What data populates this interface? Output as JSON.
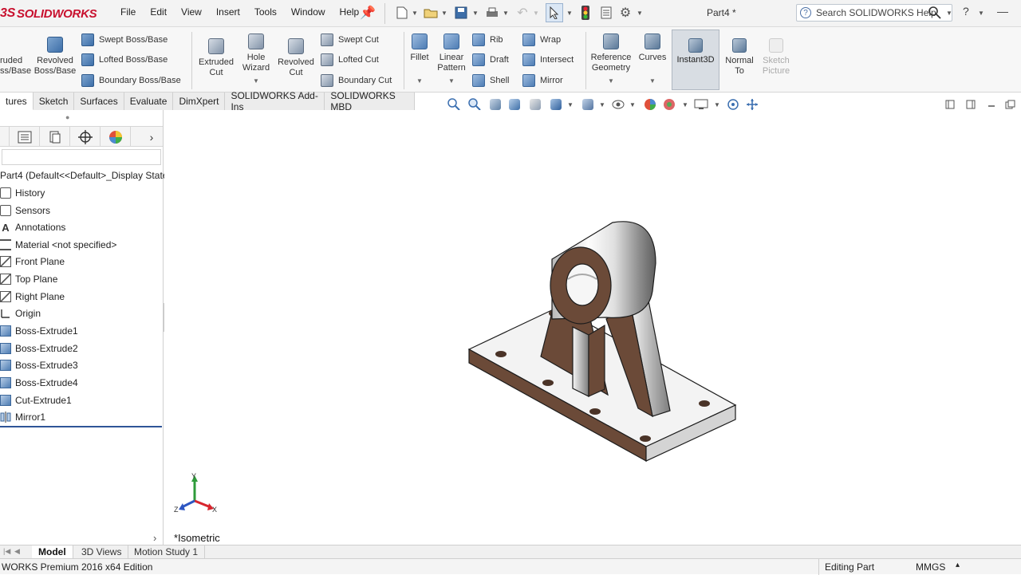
{
  "app": {
    "logo_prefix": "3S",
    "logo_text": "SOLIDWORKS",
    "doc_title": "Part4 *"
  },
  "menu": [
    "File",
    "Edit",
    "View",
    "Insert",
    "Tools",
    "Window",
    "Help"
  ],
  "search": {
    "placeholder": "Search SOLIDWORKS Help"
  },
  "window_controls": {
    "help": "?",
    "minimize": "—",
    "restore": "❐",
    "close": "✕"
  },
  "ribbon": {
    "extruded": "ruded\nss/Base",
    "revolved": "Revolved\nBoss/Base",
    "swept_boss": "Swept Boss/Base",
    "lofted_boss": "Lofted Boss/Base",
    "boundary_boss": "Boundary Boss/Base",
    "extruded_cut": "Extruded\nCut",
    "hole_wizard": "Hole\nWizard",
    "revolved_cut": "Revolved\nCut",
    "swept_cut": "Swept Cut",
    "lofted_cut": "Lofted Cut",
    "boundary_cut": "Boundary Cut",
    "fillet": "Fillet",
    "linear_pattern": "Linear\nPattern",
    "rib": "Rib",
    "draft": "Draft",
    "shell": "Shell",
    "wrap": "Wrap",
    "intersect": "Intersect",
    "mirror": "Mirror",
    "reference_geometry": "Reference\nGeometry",
    "curves": "Curves",
    "instant3d": "Instant3D",
    "normal_to": "Normal\nTo",
    "sketch_picture": "Sketch\nPicture"
  },
  "tabs": [
    "tures",
    "Sketch",
    "Surfaces",
    "Evaluate",
    "DimXpert",
    "SOLIDWORKS Add-Ins",
    "SOLIDWORKS MBD"
  ],
  "feature_tree": {
    "root": "Part4  (Default<<Default>_Display State",
    "items": [
      "History",
      "Sensors",
      "Annotations",
      "Material <not specified>",
      "Front Plane",
      "Top Plane",
      "Right Plane",
      "Origin",
      "Boss-Extrude1",
      "Boss-Extrude2",
      "Boss-Extrude3",
      "Boss-Extrude4",
      "Cut-Extrude1",
      "Mirror1"
    ]
  },
  "viewport": {
    "view_label": "*Isometric",
    "triad": {
      "x": "X",
      "y": "Y",
      "z": "Z"
    }
  },
  "bottom_tabs": [
    "Model",
    "3D Views",
    "Motion Study 1"
  ],
  "status": {
    "edition": "WORKS Premium 2016 x64 Edition",
    "mode": "Editing Part",
    "units": "MMGS"
  },
  "colors": {
    "brand": "#c8102e",
    "model_body": "#6b4a38",
    "model_top": "#f2f2f2",
    "accent": "#2f5597"
  }
}
